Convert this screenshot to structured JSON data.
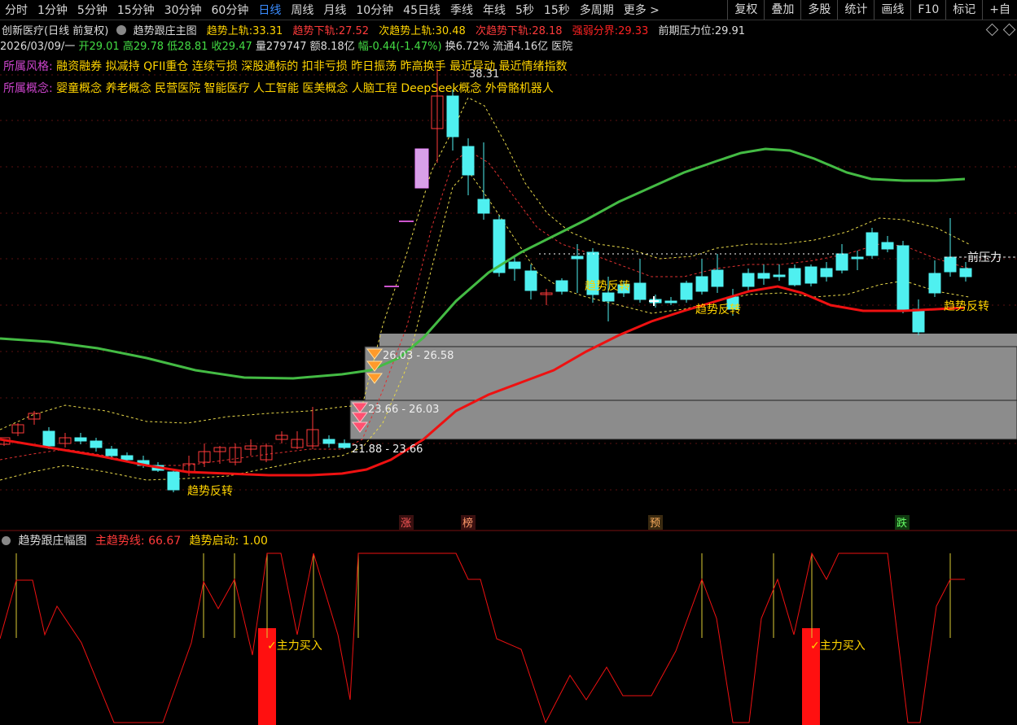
{
  "toolbar": {
    "periods": [
      "分时",
      "1分钟",
      "5分钟",
      "15分钟",
      "30分钟",
      "60分钟",
      "日线",
      "周线",
      "月线",
      "10分钟",
      "45日线",
      "季线",
      "年线",
      "5秒",
      "15秒",
      "多周期",
      "更多"
    ],
    "more_arrow": ">",
    "tools": [
      "复权",
      "叠加",
      "多股",
      "统计",
      "画线",
      "F10",
      "标记",
      "+自"
    ]
  },
  "header": {
    "stock": "创新医疗(日线 前复权)",
    "indicator": "趋势跟庄主图",
    "up_label": "趋势上轨:",
    "up_val": "33.31",
    "down_label": "趋势下轨:",
    "down_val": "27.52",
    "up2_label": "次趋势上轨:",
    "up2_val": "30.48",
    "down2_label": "次趋势下轨:",
    "down2_val": "28.18",
    "strong_label": "强弱分界:",
    "strong_val": "29.33",
    "press_label": "前期压力位:",
    "press_val": "29.91"
  },
  "quote": {
    "date": "2026/03/09/一",
    "open": "开29.01",
    "high": "高29.78",
    "low": "低28.81",
    "close": "收29.47",
    "vol": "量279747",
    "amount": "额8.18亿",
    "change": "幅-0.44(-1.47%)",
    "turnover": "换6.72%",
    "float": "流通4.16亿",
    "sector": "医院"
  },
  "styles": {
    "label": "所属风格:",
    "text": "融资融券 拟减持 QFII重仓 连续亏损 深股通标的 扣非亏损 昨日振荡 昨高换手 最近异动 最近情绪指数"
  },
  "concepts": {
    "label": "所属概念:",
    "text": "婴童概念 养老概念 民营医院 智能医疗 人工智能 医美概念 人脑工程 DeepSeek概念 外骨骼机器人"
  },
  "chart": {
    "peak": "38.31",
    "zone1": "26.03 - 26.58",
    "zone2": "23.66 - 26.03",
    "zone3": "21.88 - 23.66",
    "trend_text": "趋势反转",
    "press_text": "前压力",
    "tags": [
      "涨",
      "榜",
      "预",
      "跌"
    ]
  },
  "sub": {
    "title": "趋势跟庄幅图",
    "main_label": "主趋势线:",
    "main_val": "66.67",
    "start_label": "趋势启动:",
    "start_val": "1.00",
    "buy_text": "主力买入"
  },
  "colors": {
    "up": "#ff3a3a",
    "down": "#4ff0f0",
    "ma_green": "#44bb44",
    "ma_red": "#ee1111",
    "yellow": "#ffd400",
    "accent": "#3a8cff"
  }
}
